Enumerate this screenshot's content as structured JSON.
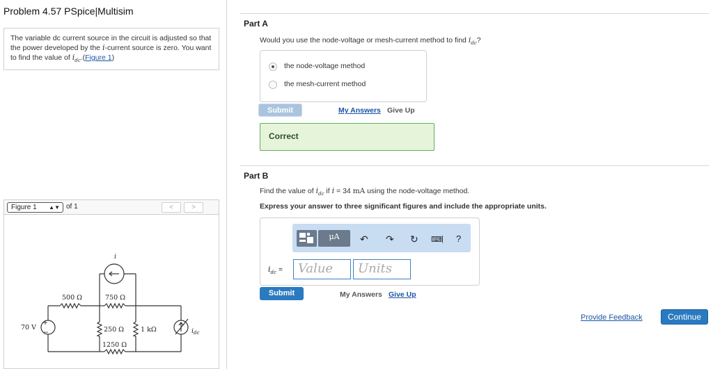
{
  "problem": {
    "title": "Problem 4.57 PSpice|Multisim",
    "text_1": "The variable dc current source in the circuit is adjusted so that the power developed by the",
    "var_i": "i",
    "text_2": "-current source is zero. You want to find the value of",
    "var_idc": "i",
    "var_idc_sub": "dc",
    "text_3": ".(",
    "figure_link": "Figure 1",
    "text_4": ")"
  },
  "figure": {
    "selected": "Figure 1",
    "of_label": "of 1",
    "prev_label": "<",
    "next_label": ">",
    "circuit_labels": {
      "source_v": "70 V",
      "r500": "500 Ω",
      "r750": "750 Ω",
      "r250": "250 Ω",
      "r1k": "1 kΩ",
      "r1250": "1250 Ω",
      "dep_i": "i",
      "idc": "i",
      "idc_sub": "dc",
      "plus": "+",
      "minus": "−"
    }
  },
  "part_a": {
    "label": "Part A",
    "question_pre": "Would you use the node-voltage or mesh-current method to find",
    "question_var": "i",
    "question_sub": "dc",
    "question_post": "?",
    "choices": [
      {
        "label": "the node-voltage method",
        "selected": true
      },
      {
        "label": "the mesh-current method",
        "selected": false
      }
    ],
    "submit_label": "Submit",
    "my_answers_label": "My Answers",
    "give_up_label": "Give Up",
    "result_label": "Correct"
  },
  "part_b": {
    "label": "Part B",
    "question_pre": "Find the value of",
    "question_var": "i",
    "question_sub": "dc",
    "question_mid": "if",
    "question_var2": "i",
    "question_eq": "= 34",
    "question_unit": "mA",
    "question_post": "using the node-voltage method.",
    "instruction": "Express your answer to three significant figures and include the appropriate units.",
    "toolbar": {
      "icons": [
        "templates-icon",
        "mu-a-units-icon",
        "undo-icon",
        "redo-icon",
        "reset-icon",
        "keyboard-icon",
        "help-icon"
      ],
      "units_glyph": "μA",
      "help_glyph": "?"
    },
    "answer_var": "i",
    "answer_sub": "dc",
    "answer_eq": "=",
    "value_placeholder": "Value",
    "units_placeholder": "Units",
    "submit_label": "Submit",
    "my_answers_label": "My Answers",
    "give_up_label": "Give Up"
  },
  "footer": {
    "feedback_label": "Provide Feedback",
    "continue_label": "Continue"
  },
  "colors": {
    "accent": "#2a7ac0",
    "correct_bg": "#e6f5d9",
    "correct_border": "#5fae5f",
    "toolbar_bg": "#c8dcf2"
  }
}
